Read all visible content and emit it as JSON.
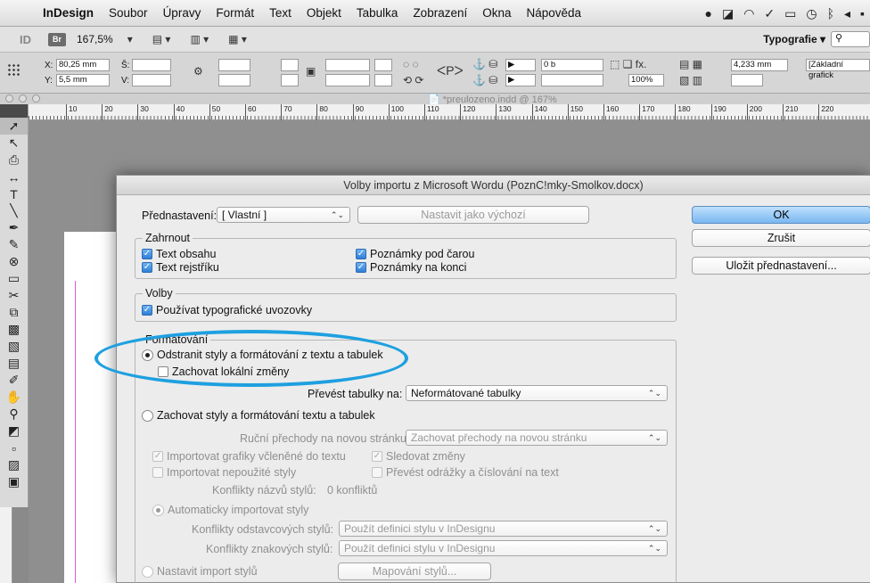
{
  "menubar": {
    "app": "InDesign",
    "items": [
      "Soubor",
      "Úpravy",
      "Formát",
      "Text",
      "Objekt",
      "Tabulka",
      "Zobrazení",
      "Okna",
      "Nápověda"
    ]
  },
  "appbar": {
    "br_label": "Br",
    "zoom": "167,5%",
    "workspace": "Typografie"
  },
  "control": {
    "x_label": "X:",
    "x_value": "80,25 mm",
    "y_label": "Y:",
    "y_value": "5,5 mm",
    "w_label": "Š:",
    "h_label": "V:",
    "stroke_value": "0 b",
    "percent_value": "100%",
    "dimension_value": "4,233 mm",
    "style_value": "[Základní grafick"
  },
  "document": {
    "title": "*preulozeno.indd @ 167%",
    "ruler_ticks": [
      "10",
      "20",
      "30",
      "40",
      "50",
      "60",
      "70",
      "80",
      "90",
      "100",
      "110",
      "120",
      "130",
      "140",
      "150",
      "160",
      "170",
      "180",
      "190",
      "200",
      "210",
      "220"
    ]
  },
  "dialog": {
    "title": "Volby importu z Microsoft Wordu (PoznC!mky-Smolkov.docx)",
    "preset_label": "Přednastavení:",
    "preset_value": "[ Vlastní ]",
    "set_default_label": "Nastavit jako výchozí",
    "ok_label": "OK",
    "cancel_label": "Zrušit",
    "save_preset_label": "Uložit přednastavení...",
    "include": {
      "title": "Zahrnout",
      "toc": "Text obsahu",
      "index": "Text rejstříku",
      "footnotes": "Poznámky pod čarou",
      "endnotes": "Poznámky na konci"
    },
    "options": {
      "title": "Volby",
      "typographic_quotes": "Používat typografické uvozovky"
    },
    "formatting": {
      "title": "Formátování",
      "remove_styles": "Odstranit styly a formátování z textu a tabulek",
      "keep_local": "Zachovat lokální změny",
      "convert_tables_label": "Převést tabulky na:",
      "convert_tables_value": "Neformátované tabulky",
      "preserve_styles": "Zachovat styly a formátování textu a tabulek",
      "page_breaks_label": "Ruční přechody na novou stránku:",
      "page_breaks_value": "Zachovat přechody na novou stránku",
      "import_inline_graphics": "Importovat grafiky včleněné do textu",
      "track_changes": "Sledovat změny",
      "import_unused_styles": "Importovat nepoužité styly",
      "convert_bullets": "Převést odrážky a číslování na text",
      "style_conflicts_label": "Konflikty názvů stylů:",
      "style_conflicts_value": "0 konfliktů",
      "auto_import": "Automaticky importovat styly",
      "para_conflicts_label": "Konflikty odstavcových stylů:",
      "para_conflicts_value": "Použít definici stylu v InDesignu",
      "char_conflicts_label": "Konflikty znakových stylů:",
      "char_conflicts_value": "Použít definici stylu v InDesignu",
      "custom_import": "Nastavit import stylů",
      "style_mapping": "Mapování stylů..."
    }
  },
  "colors": {
    "highlight": "#1ea0e0",
    "ok_button": "#7ab7f1"
  }
}
